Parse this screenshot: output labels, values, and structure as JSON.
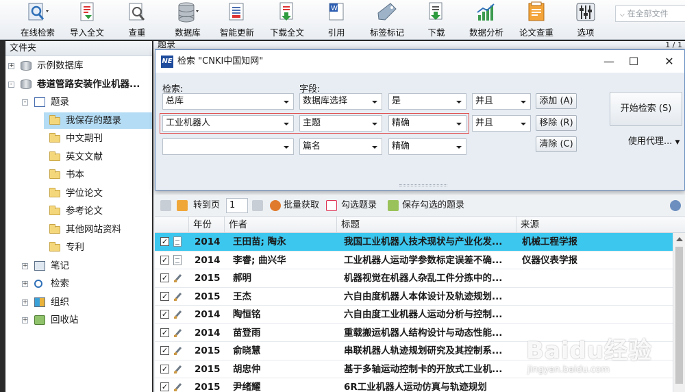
{
  "toolbar": {
    "buttons": [
      {
        "label": "在线检索",
        "icon": "online-search-icon"
      },
      {
        "label": "导入全文",
        "icon": "import-fulltext-icon"
      },
      {
        "label": "查重",
        "icon": "duplicate-check-icon"
      },
      {
        "label": "数据库",
        "icon": "database-icon"
      },
      {
        "label": "智能更新",
        "icon": "smart-update-icon"
      },
      {
        "label": "下载全文",
        "icon": "download-fulltext-icon"
      },
      {
        "label": "引用",
        "icon": "cite-icon"
      },
      {
        "label": "标签标记",
        "icon": "tag-icon"
      },
      {
        "label": "下载",
        "icon": "download-icon"
      },
      {
        "label": "数据分析",
        "icon": "data-analysis-icon"
      },
      {
        "label": "论文查重",
        "icon": "paper-check-icon"
      },
      {
        "label": "选项",
        "icon": "options-icon"
      }
    ],
    "search_placeholder": "在全部文件"
  },
  "left_panel": {
    "header": "文件夹",
    "items": [
      {
        "label": "示例数据库",
        "level": 0,
        "expander": "+",
        "icon": "database-icon"
      },
      {
        "label": "巷道管路安装作业机器...",
        "level": 0,
        "expander": "-",
        "icon": "database-icon",
        "bold": true
      },
      {
        "label": "题录",
        "level": 1,
        "expander": "-",
        "icon": "list-icon"
      },
      {
        "label": "我保存的题录",
        "level": 2,
        "icon": "folder-icon",
        "selected": true
      },
      {
        "label": "中文期刊",
        "level": 2,
        "icon": "folder-icon"
      },
      {
        "label": "英文文献",
        "level": 2,
        "icon": "folder-icon"
      },
      {
        "label": "书本",
        "level": 2,
        "icon": "folder-icon"
      },
      {
        "label": "学位论文",
        "level": 2,
        "icon": "folder-icon"
      },
      {
        "label": "参考论文",
        "level": 2,
        "icon": "folder-icon"
      },
      {
        "label": "其他网站资料",
        "level": 2,
        "icon": "folder-icon"
      },
      {
        "label": "专利",
        "level": 2,
        "icon": "folder-icon"
      },
      {
        "label": "笔记",
        "level": 1,
        "expander": "+",
        "icon": "notes-icon"
      },
      {
        "label": "检索",
        "level": 1,
        "expander": "+",
        "icon": "search-icon"
      },
      {
        "label": "组织",
        "level": 1,
        "expander": "+",
        "icon": "organize-icon"
      },
      {
        "label": "回收站",
        "level": 1,
        "expander": "+",
        "icon": "recycle-bin-icon"
      }
    ]
  },
  "right_panel": {
    "header": "题录",
    "page_count": "1 / 1"
  },
  "dialog": {
    "title": "检索 \"CNKI中国知网\"",
    "logo": "NE",
    "search_label": "检索:",
    "field_label": "字段:",
    "database": "总库",
    "rows": [
      {
        "term": "",
        "field": "数据库选择",
        "match": "是",
        "logic": "并且"
      },
      {
        "term": "工业机器人",
        "field": "主题",
        "match": "精确",
        "logic": "并且"
      },
      {
        "term": "",
        "field": "篇名",
        "match": "精确",
        "logic": ""
      }
    ],
    "add_button": "添加 (A)",
    "remove_button": "移除 (R)",
    "clear_button": "清除 (C)",
    "start_button": "开始检索 (S)",
    "proxy_label": "使用代理..."
  },
  "results_toolbar": {
    "goto_label": "转到页",
    "page_value": "1",
    "batch_label": "批量获取",
    "check_label": "勾选题录",
    "save_label": "保存勾选的题录"
  },
  "table": {
    "columns": [
      "年份",
      "作者",
      "标题",
      "来源"
    ],
    "rows": [
      {
        "year": "2014",
        "author": "王田苗; 陶永",
        "title": "我国工业机器人技术现状与产业化发...",
        "source": "机械工程学报",
        "checked": true,
        "type": "doc",
        "selected": true
      },
      {
        "year": "2014",
        "author": "李睿; 曲兴华",
        "title": "工业机器人运动学参数标定误差不确...",
        "source": "仪器仪表学报",
        "checked": true,
        "type": "doc"
      },
      {
        "year": "2015",
        "author": "郝明",
        "title": "机器视觉在机器人杂乱工件分拣中的...",
        "source": "",
        "checked": true,
        "type": "thesis"
      },
      {
        "year": "2015",
        "author": "王杰",
        "title": "六自由度机器人本体设计及轨迹规划...",
        "source": "",
        "checked": true,
        "type": "thesis"
      },
      {
        "year": "2014",
        "author": "陶恒铭",
        "title": "六自由度工业机器人运动分析与控制...",
        "source": "",
        "checked": true,
        "type": "thesis"
      },
      {
        "year": "2014",
        "author": "苗登雨",
        "title": "重载搬运机器人结构设计与动态性能...",
        "source": "",
        "checked": true,
        "type": "thesis"
      },
      {
        "year": "2015",
        "author": "俞晓慧",
        "title": "串联机器人轨迹规划研究及其控制系...",
        "source": "",
        "checked": true,
        "type": "thesis"
      },
      {
        "year": "2015",
        "author": "胡忠仲",
        "title": "基于多轴运动控制卡的开放式工业机...",
        "source": "",
        "checked": true,
        "type": "thesis"
      },
      {
        "year": "2015",
        "author": "尹绪耀",
        "title": "6R工业机器人运动仿真与轨迹规划",
        "source": "",
        "checked": true,
        "type": "thesis"
      }
    ]
  },
  "watermark": {
    "main": "Baidu经验",
    "sub": "jingyan.baidu.com"
  }
}
